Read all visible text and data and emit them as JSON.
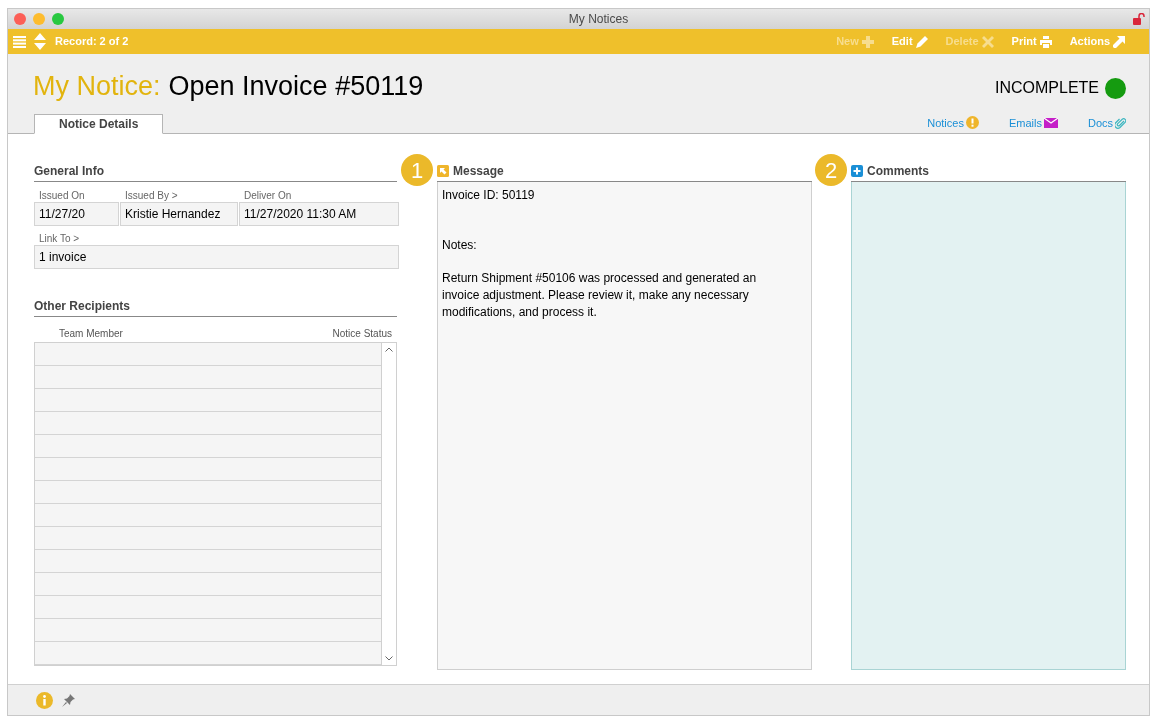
{
  "window": {
    "title": "My Notices"
  },
  "toolbar": {
    "record": "Record: 2 of 2",
    "buttons": [
      {
        "label": "New",
        "kind": "plus",
        "disabled": true
      },
      {
        "label": "Edit",
        "kind": "pencil",
        "disabled": false
      },
      {
        "label": "Delete",
        "kind": "x",
        "disabled": true
      },
      {
        "label": "Print",
        "kind": "printer",
        "disabled": false
      },
      {
        "label": "Actions",
        "kind": "arrow",
        "disabled": false
      }
    ]
  },
  "header": {
    "prefix": "My Notice:",
    "title": "Open Invoice #50119",
    "status": "INCOMPLETE"
  },
  "tabs": [
    {
      "label": "Notice Details",
      "selected": true
    }
  ],
  "links": [
    {
      "label": "Notices",
      "kind": "alert"
    },
    {
      "label": "Emails",
      "kind": "mail"
    },
    {
      "label": "Docs",
      "kind": "clip"
    }
  ],
  "general_info": {
    "title": "General Info",
    "fields": [
      {
        "label": "Issued On",
        "value": "11/27/20"
      },
      {
        "label": "Issued By >",
        "value": "Kristie Hernandez"
      },
      {
        "label": "Deliver On",
        "value": "11/27/2020 11:30 AM"
      },
      {
        "label": "Link To >",
        "value": "1 invoice"
      }
    ]
  },
  "other_recipients": {
    "title": "Other Recipients",
    "columns": [
      "Team Member",
      "Notice Status"
    ]
  },
  "message": {
    "callout": "1",
    "title": "Message",
    "lines": [
      "Invoice ID: 50119",
      "Notes:",
      "Return Shipment #50106 was processed and generated an invoice adjustment. Please review it, make any necessary modifications, and process it."
    ]
  },
  "comments": {
    "callout": "2",
    "title": "Comments"
  }
}
